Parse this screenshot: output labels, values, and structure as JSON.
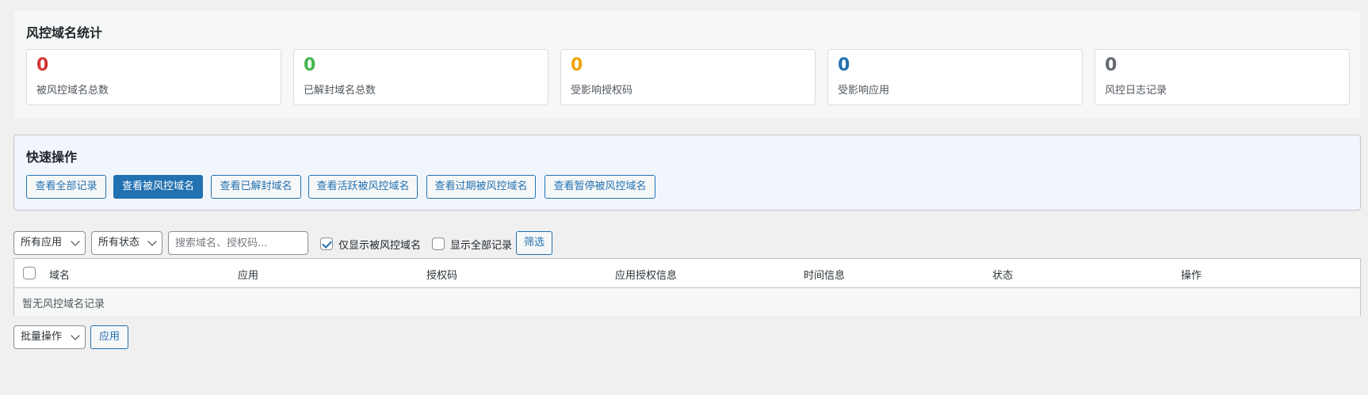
{
  "stats": {
    "title": "风控域名统计",
    "cards": [
      {
        "value": "0",
        "label": "被风控域名总数",
        "color": "#d63638"
      },
      {
        "value": "0",
        "label": "已解封域名总数",
        "color": "#46b450"
      },
      {
        "value": "0",
        "label": "受影响授权码",
        "color": "#f0a30a"
      },
      {
        "value": "0",
        "label": "受影响应用",
        "color": "#2271b1"
      },
      {
        "value": "0",
        "label": "风控日志记录",
        "color": "#646970"
      }
    ]
  },
  "quick": {
    "title": "快速操作",
    "buttons": [
      {
        "label": "查看全部记录"
      },
      {
        "label": "查看被风控域名",
        "active": true
      },
      {
        "label": "查看已解封域名"
      },
      {
        "label": "查看活跃被风控域名"
      },
      {
        "label": "查看过期被风控域名"
      },
      {
        "label": "查看暂停被风控域名"
      }
    ]
  },
  "filters": {
    "app_select": "所有应用",
    "status_select": "所有状态",
    "search_placeholder": "搜索域名、授权码...",
    "only_risk_label": "仅显示被风控域名",
    "only_risk_checked": true,
    "show_all_label": "显示全部记录",
    "show_all_checked": false,
    "filter_button": "筛选"
  },
  "table": {
    "columns": [
      "域名",
      "应用",
      "授权码",
      "应用授权信息",
      "时间信息",
      "状态",
      "操作"
    ],
    "empty_text": "暂无风控域名记录"
  },
  "bulk": {
    "select": "批量操作",
    "apply_button": "应用"
  }
}
